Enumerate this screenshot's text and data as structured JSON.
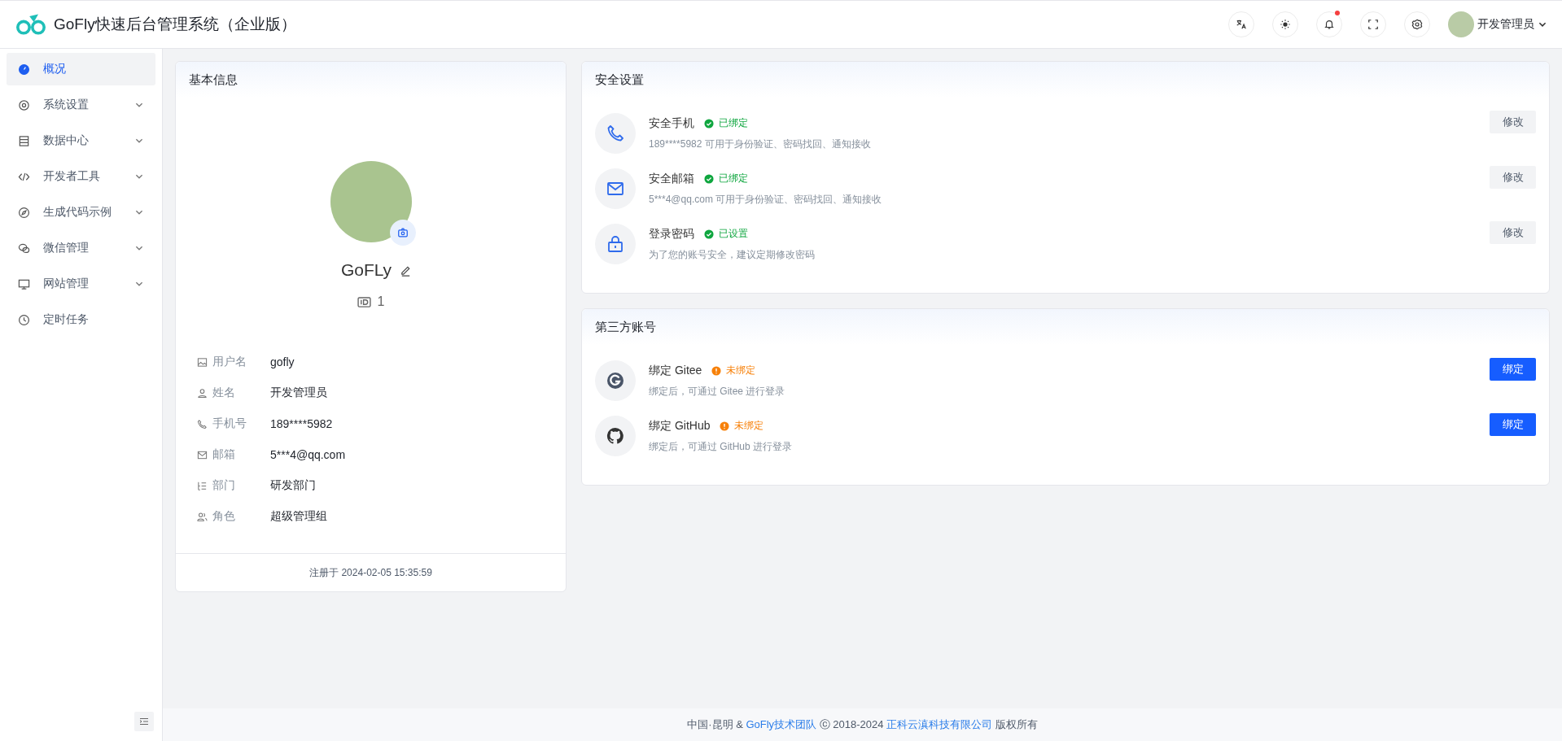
{
  "header": {
    "title": "GoFly快速后台管理系统（企业版）",
    "notification_unread": true,
    "user_name": "开发管理员"
  },
  "sidebar": {
    "items": [
      {
        "label": "概况",
        "selected": true,
        "expandable": false
      },
      {
        "label": "系统设置",
        "selected": false,
        "expandable": true
      },
      {
        "label": "数据中心",
        "selected": false,
        "expandable": true
      },
      {
        "label": "开发者工具",
        "selected": false,
        "expandable": true
      },
      {
        "label": "生成代码示例",
        "selected": false,
        "expandable": true
      },
      {
        "label": "微信管理",
        "selected": false,
        "expandable": true
      },
      {
        "label": "网站管理",
        "selected": false,
        "expandable": true
      },
      {
        "label": "定时任务",
        "selected": false,
        "expandable": false
      }
    ]
  },
  "basic_info": {
    "title": "基本信息",
    "name": "GoFLy",
    "id": "1",
    "fields": [
      {
        "label": "用户名",
        "value": "gofly"
      },
      {
        "label": "姓名",
        "value": "开发管理员"
      },
      {
        "label": "手机号",
        "value": "189****5982"
      },
      {
        "label": "邮箱",
        "value": "5***4@qq.com"
      },
      {
        "label": "部门",
        "value": "研发部门"
      },
      {
        "label": "角色",
        "value": "超级管理组"
      }
    ],
    "registered": "注册于 2024-02-05 15:35:59"
  },
  "security": {
    "title": "安全设置",
    "items": [
      {
        "title": "安全手机",
        "status": "已绑定",
        "ok": true,
        "description": "189****5982 可用于身份验证、密码找回、通知接收",
        "button": "修改",
        "primary": false
      },
      {
        "title": "安全邮箱",
        "status": "已绑定",
        "ok": true,
        "description": "5***4@qq.com 可用于身份验证、密码找回、通知接收",
        "button": "修改",
        "primary": false
      },
      {
        "title": "登录密码",
        "status": "已设置",
        "ok": true,
        "description": "为了您的账号安全，建议定期修改密码",
        "button": "修改",
        "primary": false
      }
    ]
  },
  "third_party": {
    "title": "第三方账号",
    "items": [
      {
        "title": "绑定 Gitee",
        "status": "未绑定",
        "ok": false,
        "description": "绑定后，可通过 Gitee 进行登录",
        "button": "绑定",
        "primary": true
      },
      {
        "title": "绑定 GitHub",
        "status": "未绑定",
        "ok": false,
        "description": "绑定后，可通过 GitHub 进行登录",
        "button": "绑定",
        "primary": true
      }
    ]
  },
  "footer": {
    "prefix": "中国·昆明 & ",
    "team_link": "GoFly技术团队",
    "middle": " ⓒ 2018-2024 ",
    "company_link": "正科云滇科技有限公司",
    "suffix": " 版权所有"
  }
}
